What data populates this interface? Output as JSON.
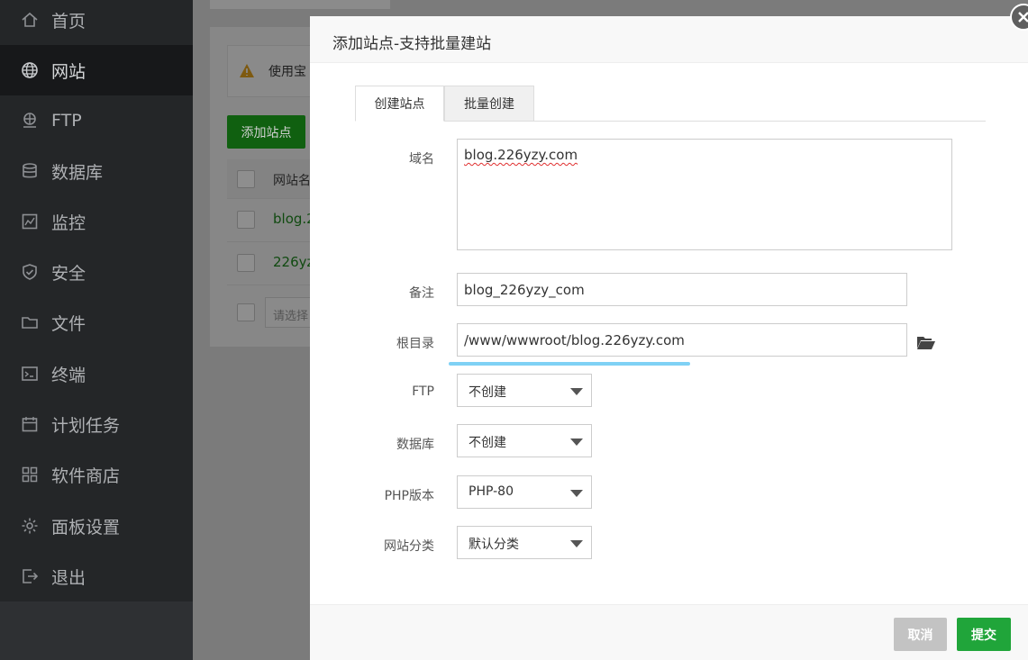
{
  "sidebar": {
    "items": [
      {
        "label": "首页",
        "icon": "home-icon",
        "active": false
      },
      {
        "label": "网站",
        "icon": "globe-icon",
        "active": true
      },
      {
        "label": "FTP",
        "icon": "ftp-icon",
        "active": false
      },
      {
        "label": "数据库",
        "icon": "database-icon",
        "active": false
      },
      {
        "label": "监控",
        "icon": "monitor-icon",
        "active": false
      },
      {
        "label": "安全",
        "icon": "shield-icon",
        "active": false
      },
      {
        "label": "文件",
        "icon": "folder-icon",
        "active": false
      },
      {
        "label": "终端",
        "icon": "terminal-icon",
        "active": false
      },
      {
        "label": "计划任务",
        "icon": "calendar-icon",
        "active": false
      },
      {
        "label": "软件商店",
        "icon": "apps-icon",
        "active": false
      },
      {
        "label": "面板设置",
        "icon": "gear-icon",
        "active": false
      },
      {
        "label": "退出",
        "icon": "logout-icon",
        "active": false
      }
    ]
  },
  "background": {
    "alert_text": "使用宝",
    "add_site_label": "添加站点",
    "table_header": "网站名",
    "rows": [
      "blog.2",
      "226yz"
    ],
    "select_placeholder": "请选择"
  },
  "modal": {
    "title": "添加站点-支持批量建站",
    "tabs": [
      {
        "label": "创建站点",
        "active": true
      },
      {
        "label": "批量创建",
        "active": false
      }
    ],
    "fields": {
      "domain": {
        "label": "域名",
        "value": "blog.226yzy.com"
      },
      "remark": {
        "label": "备注",
        "value": "blog_226yzy_com"
      },
      "root": {
        "label": "根目录",
        "value": "/www/wwwroot/blog.226yzy.com"
      },
      "ftp": {
        "label": "FTP",
        "value": "不创建"
      },
      "database": {
        "label": "数据库",
        "value": "不创建"
      },
      "php": {
        "label": "PHP版本",
        "value": "PHP-80"
      },
      "category": {
        "label": "网站分类",
        "value": "默认分类"
      }
    },
    "buttons": {
      "cancel": "取消",
      "submit": "提交"
    }
  },
  "colors": {
    "sidebar_bg": "#242628",
    "primary_green": "#20a53a",
    "input_focus_underline": "#7fd1f5"
  }
}
